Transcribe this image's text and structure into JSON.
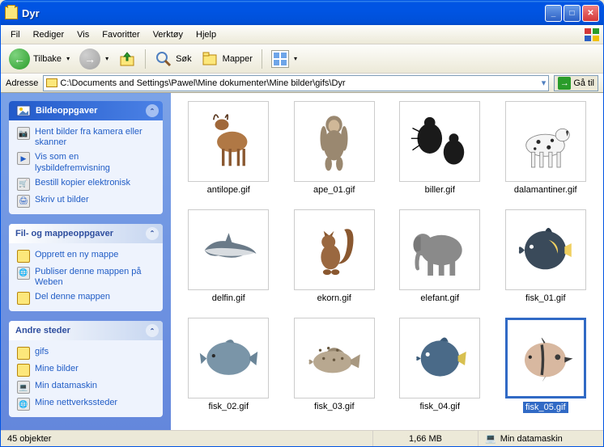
{
  "window": {
    "title": "Dyr"
  },
  "menu": [
    "Fil",
    "Rediger",
    "Vis",
    "Favoritter",
    "Verktøy",
    "Hjelp"
  ],
  "toolbar": {
    "back": "Tilbake",
    "search": "Søk",
    "folders": "Mapper"
  },
  "address": {
    "label": "Adresse",
    "path": "C:\\Documents and Settings\\Pawel\\Mine dokumenter\\Mine bilder\\gifs\\Dyr",
    "go": "Gå til"
  },
  "panels": {
    "picture": {
      "title": "Bildeoppgaver",
      "tasks": [
        "Hent bilder fra kamera eller skanner",
        "Vis som en lysbildefremvisning",
        "Bestill kopier elektronisk",
        "Skriv ut bilder"
      ]
    },
    "file": {
      "title": "Fil- og mappeoppgaver",
      "tasks": [
        "Opprett en ny mappe",
        "Publiser denne mappen på Weben",
        "Del denne mappen"
      ]
    },
    "places": {
      "title": "Andre steder",
      "tasks": [
        "gifs",
        "Mine bilder",
        "Min datamaskin",
        "Mine nettverkssteder"
      ]
    }
  },
  "files": [
    {
      "name": "antilope.gif"
    },
    {
      "name": "ape_01.gif"
    },
    {
      "name": "biller.gif"
    },
    {
      "name": "dalamantiner.gif"
    },
    {
      "name": "delfin.gif"
    },
    {
      "name": "ekorn.gif"
    },
    {
      "name": "elefant.gif"
    },
    {
      "name": "fisk_01.gif"
    },
    {
      "name": "fisk_02.gif"
    },
    {
      "name": "fisk_03.gif"
    },
    {
      "name": "fisk_04.gif"
    },
    {
      "name": "fisk_05.gif",
      "selected": true
    }
  ],
  "status": {
    "objects": "45 objekter",
    "size": "1,66 MB",
    "location": "Min datamaskin"
  }
}
